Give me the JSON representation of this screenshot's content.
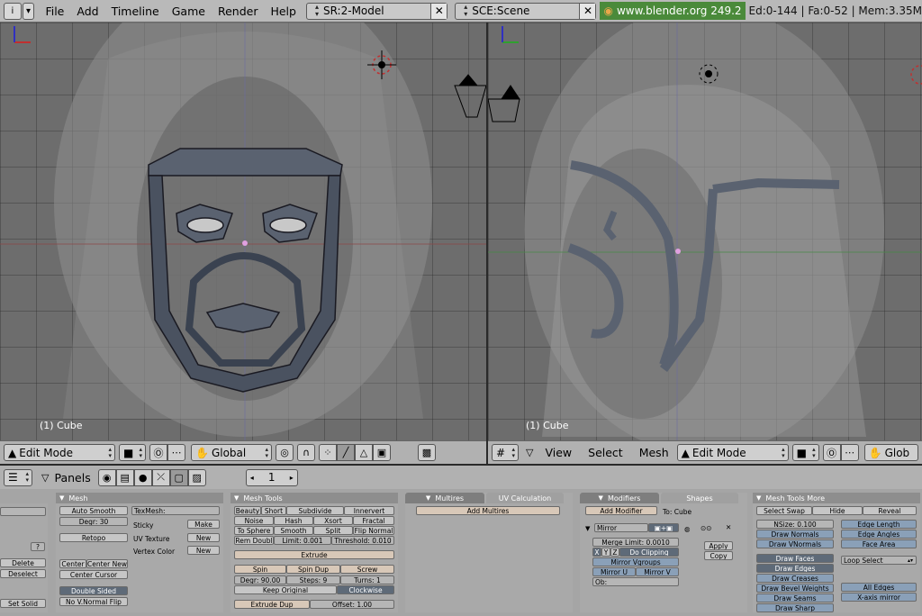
{
  "topbar": {
    "menus": [
      "File",
      "Add",
      "Timeline",
      "Game",
      "Render",
      "Help"
    ],
    "screen": "SR:2-Model",
    "scene": "SCE:Scene",
    "website": "www.blender.org 249.2",
    "stats": "Ed:0-144 | Fa:0-52 | Mem:3.35M"
  },
  "viewports": {
    "left_object": "(1) Cube",
    "right_object": "(1) Cube"
  },
  "left_header": {
    "mode": "Edit Mode",
    "orientation": "Global"
  },
  "right_header": {
    "menus": [
      "View",
      "Select",
      "Mesh"
    ],
    "mode": "Edit Mode",
    "orientation": "Glob"
  },
  "buttons_header": {
    "label": "Panels",
    "frame": "1"
  },
  "panels": {
    "left_stub": {
      "delete": "Delete",
      "deselect": "Deselect",
      "set_solid": "Set Solid",
      "q": "?"
    },
    "mesh": {
      "title": "Mesh",
      "auto_smooth": "Auto Smooth",
      "degr": "Degr: 30",
      "retopo": "Retopo",
      "texmesh": "TexMesh:",
      "sticky": "Sticky",
      "make": "Make",
      "uv_texture": "UV Texture",
      "new1": "New",
      "vertex_color": "Vertex Color",
      "new2": "New",
      "center": "Center",
      "center_new": "Center New",
      "center_cursor": "Center Cursor",
      "double_sided": "Double Sided",
      "no_vnormal_flip": "No V.Normal Flip"
    },
    "mesh_tools": {
      "title": "Mesh Tools",
      "beauty": "Beauty",
      "short": "Short",
      "subdivide": "Subdivide",
      "innervert": "Innervert",
      "noise": "Noise",
      "hash": "Hash",
      "xsort": "Xsort",
      "fractal": "Fractal",
      "to_sphere": "To Sphere",
      "smooth": "Smooth",
      "split": "Split",
      "flip_normal": "Flip Normal",
      "rem_doubl": "Rem Doubl",
      "limit": "Limit: 0.001",
      "threshold": "Threshold: 0.010",
      "extrude": "Extrude",
      "spin": "Spin",
      "spin_dup": "Spin Dup",
      "screw": "Screw",
      "degr": "Degr: 90.00",
      "steps": "Steps: 9",
      "turns": "Turns: 1",
      "keep_original": "Keep Original",
      "clockwise": "Clockwise",
      "extrude_dup": "Extrude Dup",
      "offset": "Offset: 1.00"
    },
    "multires": {
      "tab1": "Multires",
      "tab2": "UV Calculation",
      "add_multires": "Add Multires"
    },
    "modifiers": {
      "tab1": "Modifiers",
      "tab2": "Shapes",
      "add_modifier": "Add Modifier",
      "to": "To: Cube",
      "mirror": "Mirror",
      "merge_limit": "Merge Limit: 0.0010",
      "x": "X",
      "y": "Y",
      "z": "Z",
      "do_clipping": "Do Clipping",
      "mirror_vgroups": "Mirror Vgroups",
      "mirror_u": "Mirror U",
      "mirror_v": "Mirror V",
      "ob": "Ob:",
      "apply": "Apply",
      "copy": "Copy"
    },
    "mesh_tools_more": {
      "title": "Mesh Tools More",
      "select_swap": "Select Swap",
      "hide": "Hide",
      "reveal": "Reveal",
      "nsize": "NSize: 0.100",
      "draw_normals": "Draw Normals",
      "draw_vnormals": "Draw VNormals",
      "edge_length": "Edge Length",
      "edge_angles": "Edge Angles",
      "face_area": "Face Area",
      "draw_faces": "Draw Faces",
      "draw_edges": "Draw Edges",
      "draw_creases": "Draw Creases",
      "draw_bevel_weights": "Draw Bevel Weights",
      "draw_seams": "Draw Seams",
      "draw_sharp": "Draw Sharp",
      "loop_select": "Loop Select",
      "all_edges": "All Edges",
      "x_axis_mirror": "X-axis mirror"
    }
  }
}
